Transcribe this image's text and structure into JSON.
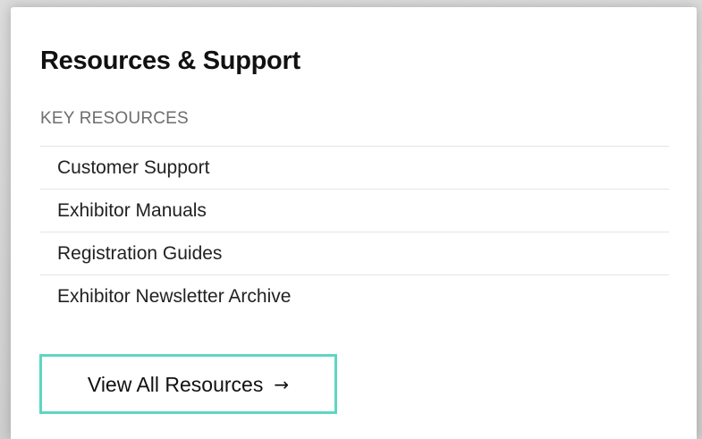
{
  "card": {
    "title": "Resources & Support",
    "section_label": "KEY RESOURCES",
    "items": [
      {
        "label": "Customer Support"
      },
      {
        "label": "Exhibitor Manuals"
      },
      {
        "label": "Registration Guides"
      },
      {
        "label": "Exhibitor Newsletter Archive"
      }
    ],
    "cta": {
      "label": "View All Resources",
      "arrow": "→"
    }
  },
  "colors": {
    "accent_border": "#5ed6c4",
    "title_text": "#111111",
    "muted_text": "#6d6d6d",
    "divider": "#e4e4e4"
  }
}
